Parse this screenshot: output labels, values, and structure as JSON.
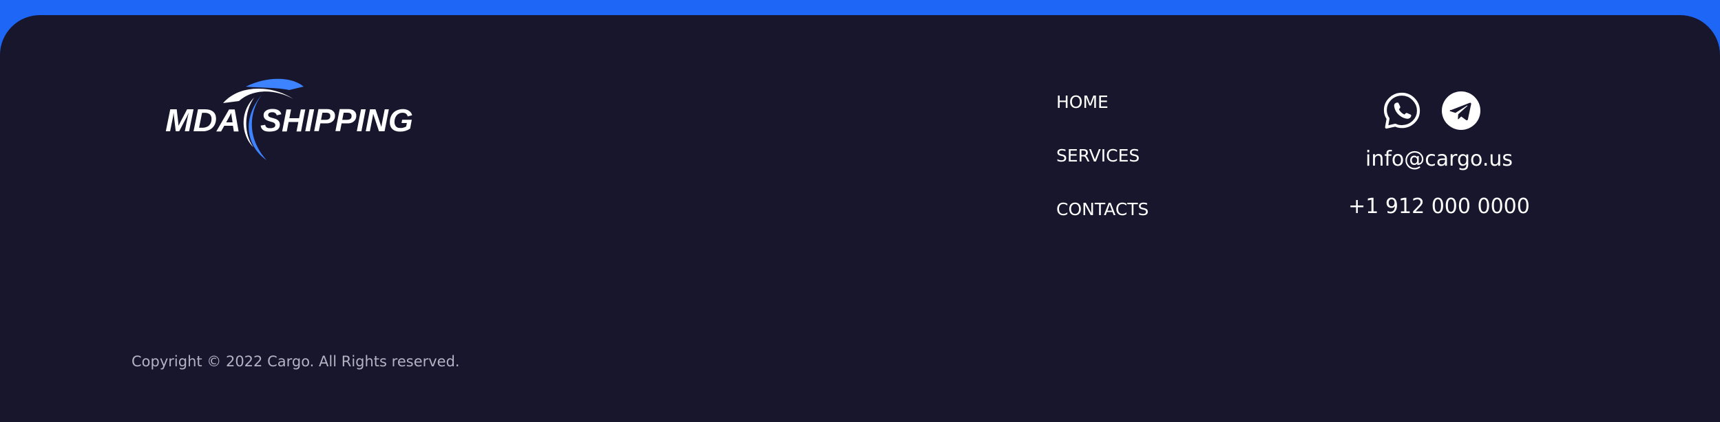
{
  "colors": {
    "top_bar": "#1e66f5",
    "footer_background": "#18162c",
    "logo_accent": "#3d82ff",
    "text_primary": "#ffffff",
    "text_muted": "#b4b2c3"
  },
  "logo": {
    "text_left": "MDA",
    "text_right": "SHIPPING"
  },
  "nav": {
    "items": [
      {
        "label": "HOME"
      },
      {
        "label": "SERVICES"
      },
      {
        "label": "CONTACTS"
      }
    ]
  },
  "contact": {
    "icons": [
      {
        "name": "whatsapp-icon"
      },
      {
        "name": "telegram-icon"
      }
    ],
    "email": "info@cargo.us",
    "phone": "+1 912 000 0000"
  },
  "footer": {
    "copyright": "Copyright © 2022 Cargo. All Rights reserved."
  }
}
